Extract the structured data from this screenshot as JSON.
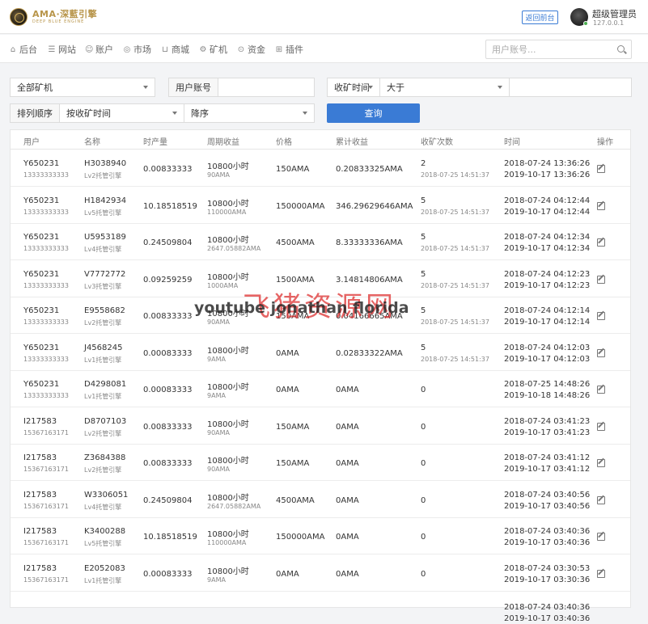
{
  "header": {
    "logo_text": "AMA·深藍引擎",
    "logo_sub": "DEEP BLUE ENGINE",
    "back_label": "返回前台",
    "admin_name": "超级管理员",
    "admin_ip": "127.0.0.1"
  },
  "nav": {
    "items": [
      {
        "label": "后台",
        "icon": "home-icon"
      },
      {
        "label": "网站",
        "icon": "list-icon"
      },
      {
        "label": "账户",
        "icon": "users-icon"
      },
      {
        "label": "市场",
        "icon": "globe-icon"
      },
      {
        "label": "商城",
        "icon": "cart-icon"
      },
      {
        "label": "矿机",
        "icon": "gear-icon"
      },
      {
        "label": "资金",
        "icon": "coin-icon"
      },
      {
        "label": "插件",
        "icon": "grid-icon"
      }
    ],
    "search_placeholder": "用户账号..."
  },
  "filters": {
    "miner_select": "全部矿机",
    "user_label": "用户账号",
    "user_value": "",
    "time_field": "收矿时间",
    "compare_op": "大于",
    "compare_value": "",
    "sort_label": "排列顺序",
    "sort_field": "按收矿时间",
    "sort_dir": "降序",
    "query_label": "查询"
  },
  "table": {
    "columns": [
      "用户",
      "名称",
      "时产量",
      "周期收益",
      "价格",
      "累计收益",
      "收矿次数",
      "时间",
      "操作"
    ],
    "rows": [
      {
        "user": "Y650231",
        "phone": "13333333333",
        "code": "H3038940",
        "miner": "Lv2托管引擎",
        "rate": "0.00833333",
        "cycle": "10800小时",
        "cycle_sub": "90AMA",
        "price": "150AMA",
        "total": "0.20833325AMA",
        "count": "2",
        "count_sub": "2018-07-25 14:51:37",
        "time1": "2018-07-24 13:36:26",
        "time2": "2019-10-17 13:36:26"
      },
      {
        "user": "Y650231",
        "phone": "13333333333",
        "code": "H1842934",
        "miner": "Lv5托管引擎",
        "rate": "10.18518519",
        "cycle": "10800小时",
        "cycle_sub": "110000AMA",
        "price": "150000AMA",
        "total": "346.29629646AMA",
        "count": "5",
        "count_sub": "2018-07-25 14:51:37",
        "time1": "2018-07-24 04:12:44",
        "time2": "2019-10-17 04:12:44"
      },
      {
        "user": "Y650231",
        "phone": "13333333333",
        "code": "U5953189",
        "miner": "Lv4托管引擎",
        "rate": "0.24509804",
        "cycle": "10800小时",
        "cycle_sub": "2647.05882AMA",
        "price": "4500AMA",
        "total": "8.33333336AMA",
        "count": "5",
        "count_sub": "2018-07-25 14:51:37",
        "time1": "2018-07-24 04:12:34",
        "time2": "2019-10-17 04:12:34"
      },
      {
        "user": "Y650231",
        "phone": "13333333333",
        "code": "V7772772",
        "miner": "Lv3托管引擎",
        "rate": "0.09259259",
        "cycle": "10800小时",
        "cycle_sub": "1000AMA",
        "price": "1500AMA",
        "total": "3.14814806AMA",
        "count": "5",
        "count_sub": "2018-07-25 14:51:37",
        "time1": "2018-07-24 04:12:23",
        "time2": "2019-10-17 04:12:23"
      },
      {
        "user": "Y650231",
        "phone": "13333333333",
        "code": "E9558682",
        "miner": "Lv2托管引擎",
        "rate": "0.00833333",
        "cycle": "10800小时",
        "cycle_sub": "90AMA",
        "price": "150AMA",
        "total": "0.04166665AMA",
        "count": "5",
        "count_sub": "2018-07-25 14:51:37",
        "time1": "2018-07-24 04:12:14",
        "time2": "2019-10-17 04:12:14"
      },
      {
        "user": "Y650231",
        "phone": "13333333333",
        "code": "J4568245",
        "miner": "Lv1托管引擎",
        "rate": "0.00083333",
        "cycle": "10800小时",
        "cycle_sub": "9AMA",
        "price": "0AMA",
        "total": "0.02833322AMA",
        "count": "5",
        "count_sub": "2018-07-25 14:51:37",
        "time1": "2018-07-24 04:12:03",
        "time2": "2019-10-17 04:12:03"
      },
      {
        "user": "Y650231",
        "phone": "13333333333",
        "code": "D4298081",
        "miner": "Lv1托管引擎",
        "rate": "0.00083333",
        "cycle": "10800小时",
        "cycle_sub": "9AMA",
        "price": "0AMA",
        "total": "0AMA",
        "count": "0",
        "count_sub": "",
        "time1": "2018-07-25 14:48:26",
        "time2": "2019-10-18 14:48:26"
      },
      {
        "user": "I217583",
        "phone": "15367163171",
        "code": "D8707103",
        "miner": "Lv2托管引擎",
        "rate": "0.00833333",
        "cycle": "10800小时",
        "cycle_sub": "90AMA",
        "price": "150AMA",
        "total": "0AMA",
        "count": "0",
        "count_sub": "",
        "time1": "2018-07-24 03:41:23",
        "time2": "2019-10-17 03:41:23"
      },
      {
        "user": "I217583",
        "phone": "15367163171",
        "code": "Z3684388",
        "miner": "Lv2托管引擎",
        "rate": "0.00833333",
        "cycle": "10800小时",
        "cycle_sub": "90AMA",
        "price": "150AMA",
        "total": "0AMA",
        "count": "0",
        "count_sub": "",
        "time1": "2018-07-24 03:41:12",
        "time2": "2019-10-17 03:41:12"
      },
      {
        "user": "I217583",
        "phone": "15367163171",
        "code": "W3306051",
        "miner": "Lv4托管引擎",
        "rate": "0.24509804",
        "cycle": "10800小时",
        "cycle_sub": "2647.05882AMA",
        "price": "4500AMA",
        "total": "0AMA",
        "count": "0",
        "count_sub": "",
        "time1": "2018-07-24 03:40:56",
        "time2": "2019-10-17 03:40:56"
      },
      {
        "user": "I217583",
        "phone": "15367163171",
        "code": "K3400288",
        "miner": "Lv5托管引擎",
        "rate": "10.18518519",
        "cycle": "10800小时",
        "cycle_sub": "110000AMA",
        "price": "150000AMA",
        "total": "0AMA",
        "count": "0",
        "count_sub": "",
        "time1": "2018-07-24 03:40:36",
        "time2": "2019-10-17 03:40:36"
      },
      {
        "user": "I217583",
        "phone": "15367163171",
        "code": "E2052083",
        "miner": "Lv1托管引擎",
        "rate": "0.00083333",
        "cycle": "10800小时",
        "cycle_sub": "9AMA",
        "price": "0AMA",
        "total": "0AMA",
        "count": "0",
        "count_sub": "",
        "time1": "2018-07-24 03:30:53",
        "time2": "2019-10-17 03:30:36"
      }
    ],
    "overflow_time1": "2018-07-24 03:40:36",
    "overflow_time2": "2019-10-17 03:40:36"
  },
  "watermark": {
    "cn": "飞猪资源网",
    "en": "youtube jonathan florida"
  },
  "colors": {
    "accent": "#3a7bd5",
    "logo_gold": "#b8954a",
    "online": "#4caf50"
  }
}
